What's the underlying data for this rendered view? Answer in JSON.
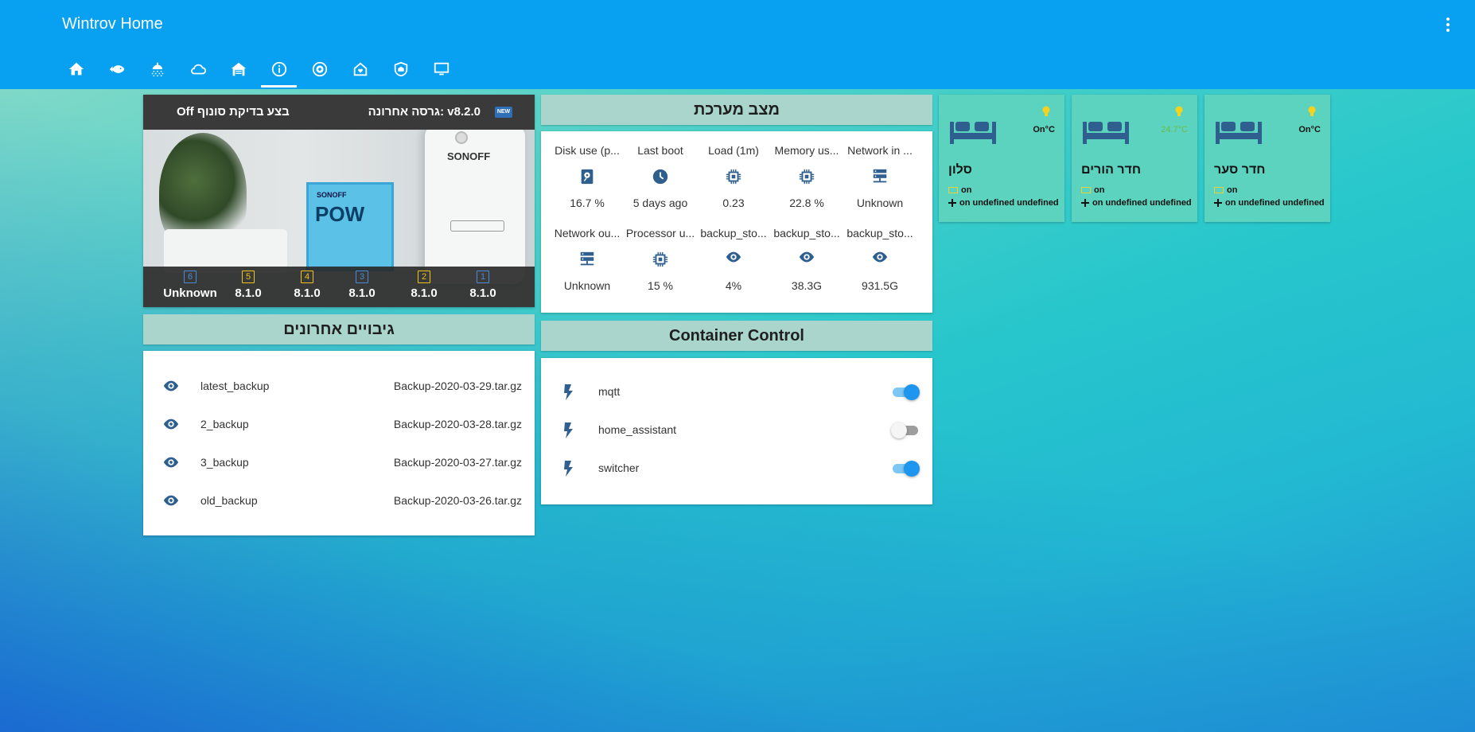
{
  "app": {
    "title": "Wintrov Home"
  },
  "tabs": [
    {
      "icon": "home-icon"
    },
    {
      "icon": "fish-icon"
    },
    {
      "icon": "shower-icon"
    },
    {
      "icon": "cloud-icon"
    },
    {
      "icon": "garage-icon"
    },
    {
      "icon": "info-icon",
      "active": true
    },
    {
      "icon": "robot-vacuum-icon"
    },
    {
      "icon": "home-heart-icon"
    },
    {
      "icon": "security-shield-icon"
    },
    {
      "icon": "monitor-icon"
    }
  ],
  "sonoff_card": {
    "check_label": "בצע בדיקת סונוף Off",
    "latest_version": "גרסה אחרונה: v8.2.0",
    "badge": "NEW",
    "photo_brand": "SONOFF",
    "photo_product": "POW",
    "versions": [
      {
        "num": "6",
        "value": "Unknown",
        "color": "#4a8ad8"
      },
      {
        "num": "5",
        "value": "8.1.0",
        "color": "#f3c21b"
      },
      {
        "num": "4",
        "value": "8.1.0",
        "color": "#f3c21b"
      },
      {
        "num": "3",
        "value": "8.1.0",
        "color": "#4a8ad8"
      },
      {
        "num": "2",
        "value": "8.1.0",
        "color": "#f3c21b"
      },
      {
        "num": "1",
        "value": "8.1.0",
        "color": "#4a8ad8"
      }
    ]
  },
  "backups": {
    "title": "גיבויים אחרונים",
    "rows": [
      {
        "name": "latest_backup",
        "file": "Backup-2020-03-29.tar.gz"
      },
      {
        "name": "2_backup",
        "file": "Backup-2020-03-28.tar.gz"
      },
      {
        "name": "3_backup",
        "file": "Backup-2020-03-27.tar.gz"
      },
      {
        "name": "old_backup",
        "file": "Backup-2020-03-26.tar.gz"
      }
    ]
  },
  "system": {
    "title": "מצב מערכת",
    "row1": [
      {
        "label": "Disk use (p...",
        "icon": "harddisk-icon",
        "value": "16.7 %"
      },
      {
        "label": "Last boot",
        "icon": "clock-icon",
        "value": "5 days ago"
      },
      {
        "label": "Load (1m)",
        "icon": "chip-icon",
        "value": "0.23"
      },
      {
        "label": "Memory us...",
        "icon": "chip-icon",
        "value": "22.8 %"
      },
      {
        "label": "Network in ...",
        "icon": "server-network-icon",
        "value": "Unknown"
      }
    ],
    "row2": [
      {
        "label": "Network ou...",
        "icon": "server-network-icon",
        "value": "Unknown"
      },
      {
        "label": "Processor u...",
        "icon": "chip-icon",
        "value": "15 %"
      },
      {
        "label": "backup_sto...",
        "icon": "eye-icon",
        "value": "4%"
      },
      {
        "label": "backup_sto...",
        "icon": "eye-icon",
        "value": "38.3G"
      },
      {
        "label": "backup_sto...",
        "icon": "eye-icon",
        "value": "931.5G"
      }
    ]
  },
  "containers": {
    "title": "Container Control",
    "rows": [
      {
        "name": "mqtt",
        "state": "on"
      },
      {
        "name": "home_assistant",
        "state": "off"
      },
      {
        "name": "switcher",
        "state": "on"
      }
    ]
  },
  "rooms": [
    {
      "name": "סלון",
      "temp": "On°C",
      "light": "on",
      "fan": "on undefined undefined"
    },
    {
      "name": "חדר הורים",
      "temp": "24.7°C",
      "light": "on",
      "fan": "on undefined undefined"
    },
    {
      "name": "חדר סער",
      "temp": "On°C",
      "light": "on",
      "fan": "on undefined undefined"
    }
  ],
  "colors": {
    "topbar": "#08a0f0",
    "accent_icon": "#2f5f8f",
    "toggle_on": "#1e96f0",
    "room_card": "#5bd3bf",
    "card_header": "#a9d5cc"
  }
}
